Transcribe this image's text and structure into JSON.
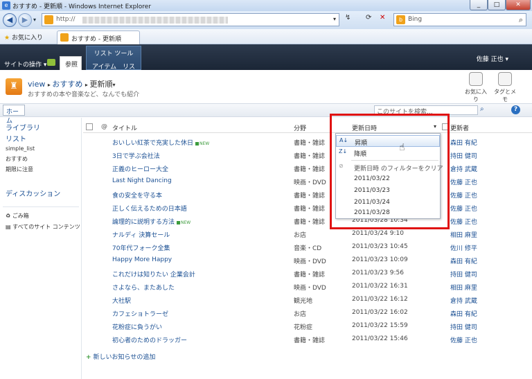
{
  "window": {
    "title": "おすすめ - 更新順 - Windows Internet Explorer",
    "min": "_",
    "max": "□",
    "close": "✕"
  },
  "address": {
    "prefix": "http://",
    "search_engine": "Bing"
  },
  "favorites": {
    "label": "お気に入り",
    "tab": "おすすめ - 更新順"
  },
  "ribbon": {
    "site_actions": "サイトの操作 ▾",
    "browse": "参照",
    "list_tools": "リスト ツール",
    "items": "アイテム",
    "list": "リスト",
    "user": "佐藤 正也 ▾"
  },
  "header": {
    "crumb1": "view",
    "crumb2": "おすすめ",
    "crumb3": "更新順",
    "subtitle": "おすすめの本や音楽など、なんでも紹介",
    "like": "お気に入り",
    "tags": "タグとメモ"
  },
  "nav": {
    "home": "ホーム",
    "search_placeholder": "このサイトを検索..."
  },
  "leftnav": {
    "libraries": "ライブラリ",
    "lists": "リスト",
    "simple": "simple_list",
    "osusume": "おすすめ",
    "period": "期限に注意",
    "discussion": "ディスカッション",
    "recycle": "ごみ箱",
    "all": "すべてのサイト コンテンツ"
  },
  "columns": {
    "title": "タイトル",
    "category": "分野",
    "modified": "更新日時",
    "editor": "更新者"
  },
  "rows": [
    {
      "title": "おいしい紅茶で充実した休日",
      "new": true,
      "cat": "書籍・雑誌",
      "date": "",
      "user": "森田 有紀"
    },
    {
      "title": "3日で学ぶ会社法",
      "new": false,
      "cat": "書籍・雑誌",
      "date": "",
      "user": "持田 健司"
    },
    {
      "title": "正義のヒーロー大全",
      "new": false,
      "cat": "書籍・雑誌",
      "date": "",
      "user": "倉持 武蔵"
    },
    {
      "title": "Last Night Dancing",
      "new": false,
      "cat": "映画・DVD",
      "date": "",
      "user": "佐藤 正也"
    },
    {
      "title": "食の安全を守る本",
      "new": false,
      "cat": "書籍・雑誌",
      "date": "",
      "user": "佐藤 正也"
    },
    {
      "title": "正しく伝えるための日本語",
      "new": false,
      "cat": "書籍・雑誌",
      "date": "",
      "user": "佐藤 正也"
    },
    {
      "title": "論理的に説明する方法",
      "new": true,
      "cat": "書籍・雑誌",
      "date": "2011/03/28 10:34",
      "user": "佐藤 正也"
    },
    {
      "title": "ナルディ 決算セール",
      "new": false,
      "cat": "お店",
      "date": "2011/03/24 9:10",
      "user": "相田 麻里"
    },
    {
      "title": "70年代フォーク全集",
      "new": false,
      "cat": "音楽・CD",
      "date": "2011/03/23 10:45",
      "user": "佐川 修平"
    },
    {
      "title": "Happy More Happy",
      "new": false,
      "cat": "映画・DVD",
      "date": "2011/03/23 10:09",
      "user": "森田 有紀"
    },
    {
      "title": "これだけは知りたい 企業会計",
      "new": false,
      "cat": "書籍・雑誌",
      "date": "2011/03/23 9:56",
      "user": "持田 健司"
    },
    {
      "title": "さよなら、またあした",
      "new": false,
      "cat": "映画・DVD",
      "date": "2011/03/22 16:31",
      "user": "相田 麻里"
    },
    {
      "title": "大社駅",
      "new": false,
      "cat": "観光地",
      "date": "2011/03/22 16:12",
      "user": "倉持 武蔵"
    },
    {
      "title": "カフェショトラーゼ",
      "new": false,
      "cat": "お店",
      "date": "2011/03/22 16:02",
      "user": "森田 有紀"
    },
    {
      "title": "花粉症に負うがい",
      "new": false,
      "cat": "花粉症",
      "date": "2011/03/22 15:59",
      "user": "持田 健司"
    },
    {
      "title": "初心者のためのドラッガー",
      "new": false,
      "cat": "書籍・雑誌",
      "date": "2011/03/22 15:46",
      "user": "佐藤 正也"
    }
  ],
  "new_badge": "NEW",
  "dropdown": {
    "asc": "昇順",
    "desc": "降順",
    "clear": "更新日時 のフィルターをクリア",
    "filters": [
      "2011/03/22",
      "2011/03/23",
      "2011/03/24",
      "2011/03/28"
    ]
  },
  "add_new": "新しいお知らせの追加"
}
